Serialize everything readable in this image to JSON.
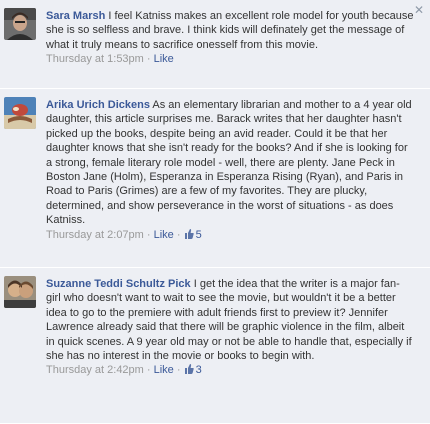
{
  "comments": [
    {
      "author": "Sara Marsh",
      "text": "I feel Katniss makes an excellent role model for youth because she is so selfless and brave. I think kids will definately get the message of what it truly means to sacrifice onesself from this movie.",
      "time": "Thursday at 1:53pm",
      "sep": " · ",
      "like_label": "Like",
      "like_count": ""
    },
    {
      "author": "Arika Urich Dickens",
      "text": "As an elementary librarian and mother to a 4 year old daughter, this article surprises me. Barack writes that her daughter hasn't picked up the books, despite being an avid reader. Could it be that her daughter knows that she isn't ready for the books? And if she is looking for a strong, female literary role model - well, there are plenty. Jane Peck in Boston Jane (Holm), Esperanza in Esperanza Rising (Ryan), and Paris in Road to Paris (Grimes) are a few of my favorites. They are plucky, determined, and show perseverance in the worst of situations - as does Katniss.",
      "time": "Thursday at 2:07pm",
      "sep": " · ",
      "like_label": "Like",
      "sep2": " · ",
      "like_count": "5"
    },
    {
      "author": "Suzanne Teddi Schultz Pick",
      "text": "I get the idea that the writer is a major fan-girl who doesn't want to wait to see the movie, but wouldn't it be a better idea to go to the premiere with adult friends first to preview it? Jennifer Lawrence already said that there will be graphic violence in the film, albeit in quick scenes. A 9 year old may or not be able to handle that, especially if she has no interest in the movie or books to begin with.",
      "time": "Thursday at 2:42pm",
      "sep": " · ",
      "like_label": "Like",
      "sep2": " · ",
      "like_count": "3"
    }
  ],
  "close_glyph": "✕",
  "colors": {
    "comment_bg": "#edeff4",
    "link": "#3b5998",
    "meta": "#999999",
    "text": "#333333"
  }
}
